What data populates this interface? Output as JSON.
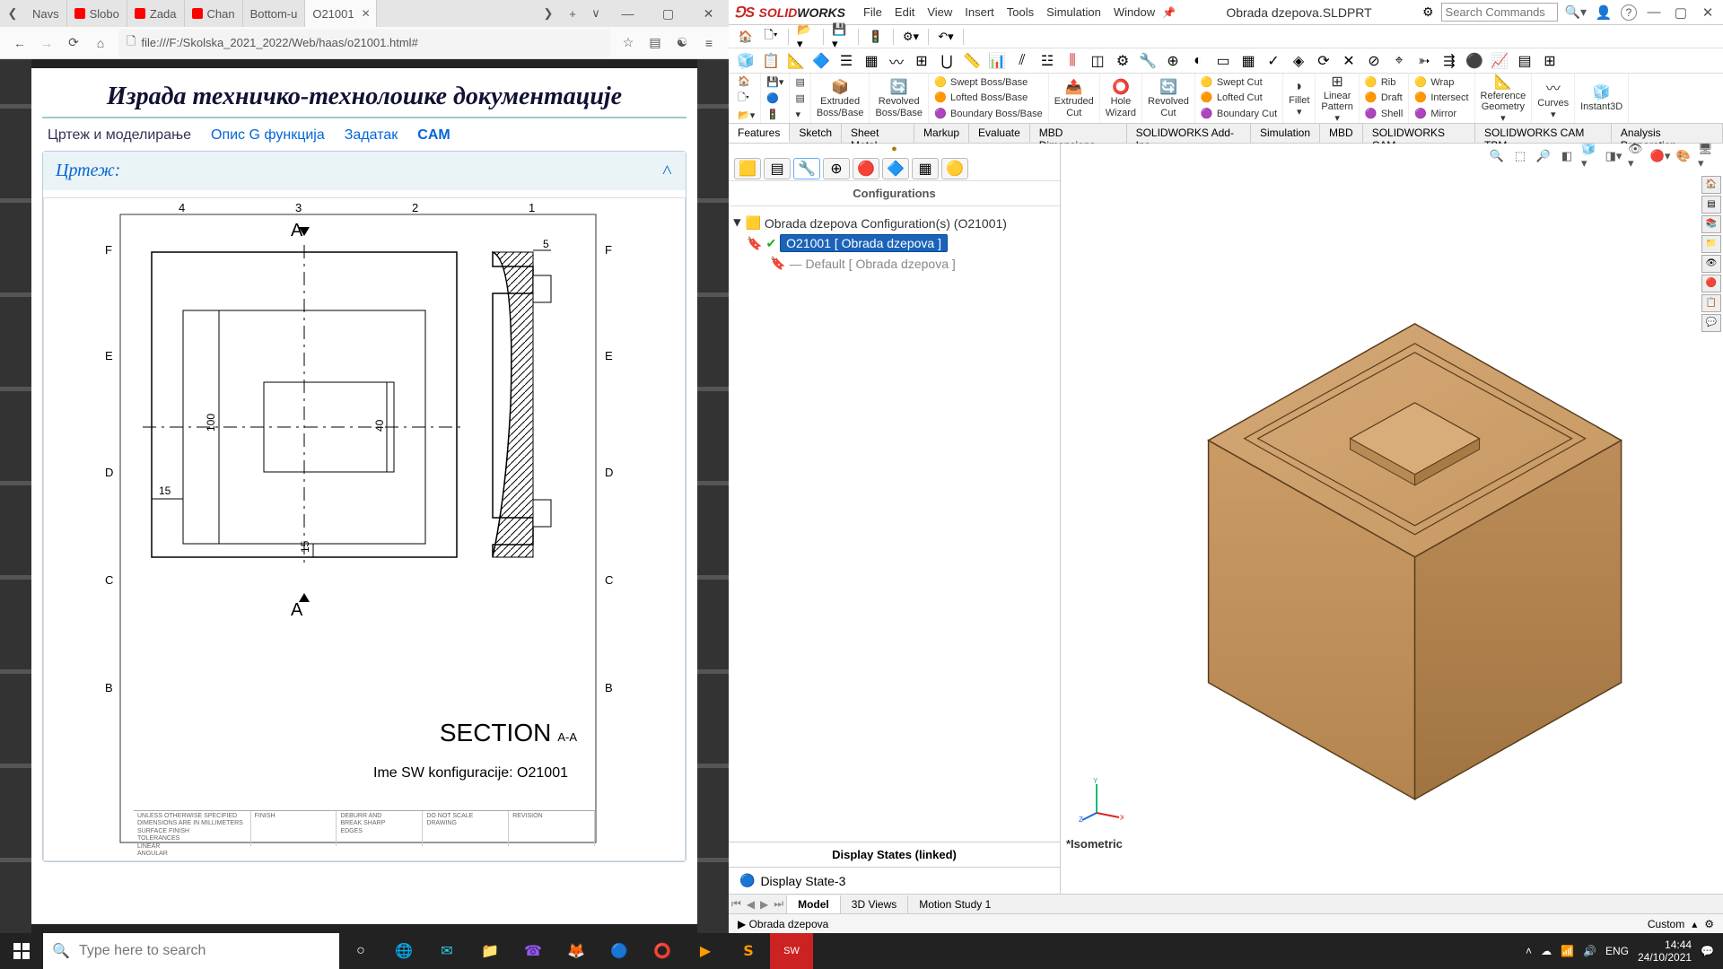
{
  "browser": {
    "tabs": [
      {
        "icon": "",
        "label": "Navs"
      },
      {
        "icon": "yt",
        "label": "Slobo"
      },
      {
        "icon": "yt",
        "label": "Zada"
      },
      {
        "icon": "yt",
        "label": "Chan"
      },
      {
        "icon": "",
        "label": "Bottom-u"
      },
      {
        "icon": "",
        "label": "O21001",
        "active": true
      }
    ],
    "url": "file:///F:/Skolska_2021_2022/Web/haas/o21001.html#"
  },
  "page": {
    "title": "Израда техничко-технолошке документације",
    "tabs": [
      "Цртеж и моделирање",
      "Опис G функција",
      "Задатак",
      "CAM"
    ],
    "collapse": "Цртеж:",
    "section": "SECTION",
    "section_sub": "A-A",
    "cfg": "Ime SW konfiguracije: O21001",
    "dims": {
      "t1": "4",
      "t2": "3",
      "t3": "2",
      "t4": "1",
      "a": "A",
      "b": "B",
      "c": "C",
      "d": "D",
      "e": "E",
      "f": "F",
      "d100": "100",
      "d40": "40",
      "d15": "15",
      "d5": "5"
    },
    "tb": {
      "c1": "UNLESS OTHERWISE SPECIFIED\nDIMENSIONS ARE IN MILLIMETERS\nSURFACE FINISH\nTOLERANCES\nLINEAR\nANGULAR",
      "c2": "FINISH",
      "c3": "DEBURR AND\nBREAK SHARP\nEDGES",
      "c4": "DO NOT SCALE DRAWING",
      "c5": "REVISION"
    }
  },
  "sw": {
    "logo_a": "SOLID",
    "logo_b": "WORKS",
    "menubar": [
      "File",
      "Edit",
      "View",
      "Insert",
      "Tools",
      "Simulation",
      "Window"
    ],
    "filename": "Obrada dzepova.SLDPRT",
    "search_ph": "Search Commands",
    "ribbon_big": [
      {
        "label": "Extruded\nBoss/Base"
      },
      {
        "label": "Revolved\nBoss/Base"
      },
      {
        "label": "Extruded\nCut"
      },
      {
        "label": "Hole\nWizard"
      },
      {
        "label": "Revolved\nCut"
      },
      {
        "label": "Fillet"
      },
      {
        "label": "Linear\nPattern"
      },
      {
        "label": "Reference\nGeometry"
      },
      {
        "label": "Curves"
      },
      {
        "label": "Instant3D"
      }
    ],
    "ribbon_rows1": [
      "Swept Boss/Base",
      "Lofted Boss/Base",
      "Boundary Boss/Base"
    ],
    "ribbon_rows2": [
      "Swept Cut",
      "Lofted Cut",
      "Boundary Cut"
    ],
    "ribbon_rows3": [
      "Rib",
      "Draft",
      "Shell"
    ],
    "ribbon_rows4": [
      "Wrap",
      "Intersect",
      "Mirror"
    ],
    "cmdtabs": [
      "Features",
      "Sketch",
      "Sheet Metal",
      "Markup",
      "Evaluate",
      "MBD Dimensions",
      "SOLIDWORKS Add-Ins",
      "Simulation",
      "MBD",
      "SOLIDWORKS CAM",
      "SOLIDWORKS CAM TBM",
      "Analysis Preparation"
    ],
    "tree": {
      "hd": "Configurations",
      "root": "Obrada dzepova Configuration(s)  (O21001)",
      "cfg1": "O21001 [ Obrada dzepova ]",
      "cfg2": "Default [ Obrada dzepova ]",
      "disp_hd": "Display States (linked)",
      "disp": "Display State-3"
    },
    "iso": "*Isometric",
    "btabs": [
      "Model",
      "3D Views",
      "Motion Study 1"
    ],
    "status": "Obrada dzepova",
    "custom": "Custom"
  },
  "taskbar": {
    "search_ph": "Type here to search",
    "lang": "ENG",
    "time": "14:44",
    "date": "24/10/2021"
  }
}
